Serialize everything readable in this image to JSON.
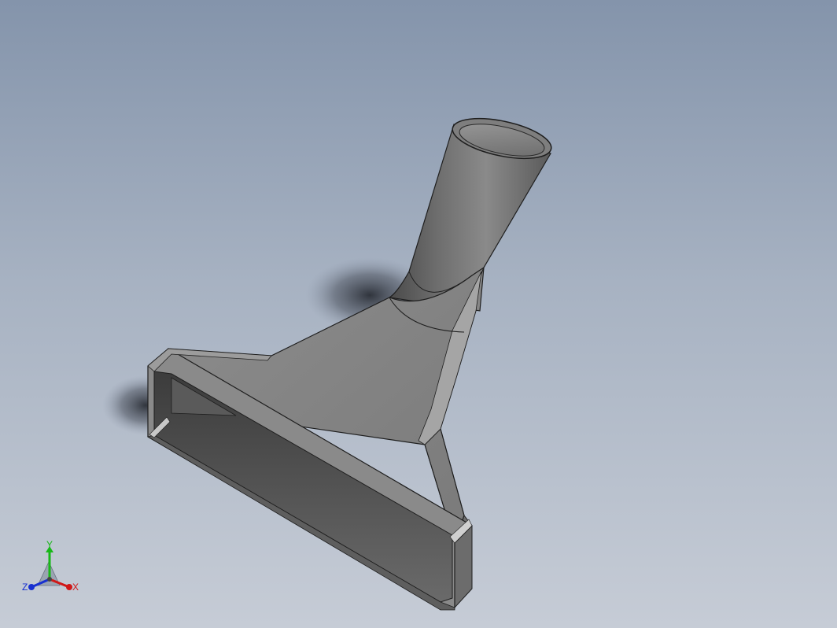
{
  "viewport": {
    "background_top": "#8494ab",
    "background_bottom": "#c6ccd6"
  },
  "model": {
    "icon": "nozzle-part-model",
    "body_color": "#7f7f7f",
    "edge_color": "#1e1e1e"
  },
  "triad": {
    "x_label": "X",
    "y_label": "Y",
    "z_label": "Z",
    "x_color": "#d01818",
    "y_color": "#18b818",
    "z_color": "#1830d0"
  }
}
